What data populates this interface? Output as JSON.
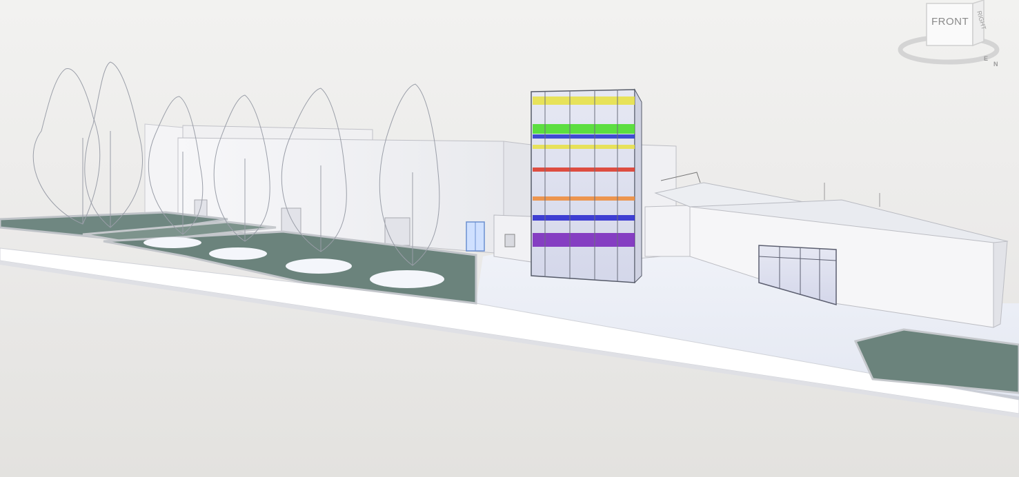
{
  "viewcube": {
    "front_label": "FRONT",
    "right_label": "RIGHT",
    "compass_e": "E",
    "compass_n": "N"
  },
  "scene": {
    "tower_floor_colors": [
      "#e8e040",
      "#44dd22",
      "#2233cc",
      "#e8e040",
      "#dd3322",
      "#ee8833",
      "#2222cc",
      "#7722bb"
    ]
  }
}
